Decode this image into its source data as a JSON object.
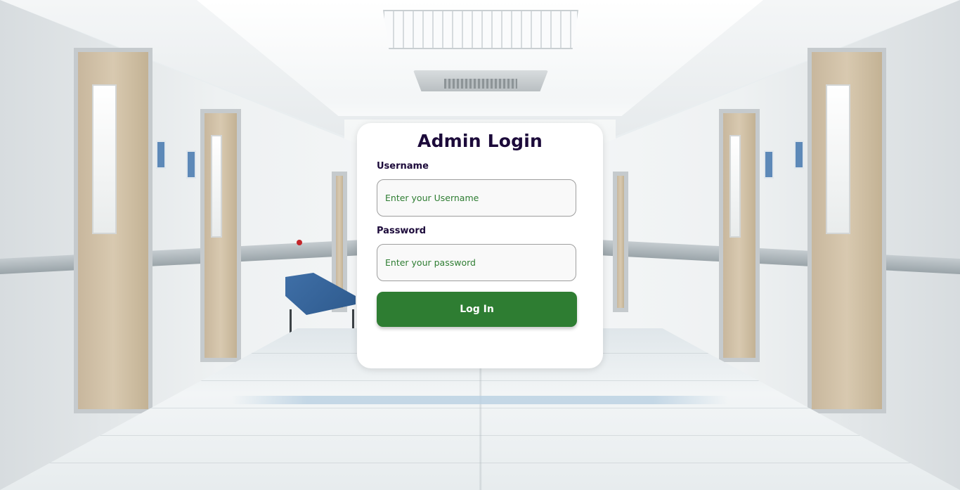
{
  "login": {
    "title": "Admin Login",
    "username_label": "Username",
    "username_placeholder": "Enter your Username",
    "username_value": "",
    "password_label": "Password",
    "password_placeholder": "Enter your password",
    "password_value": "",
    "submit_label": "Log In"
  },
  "theme": {
    "accent": "#2e7d32",
    "title_color": "#1c0a3a",
    "card_background": "#ffffff"
  }
}
